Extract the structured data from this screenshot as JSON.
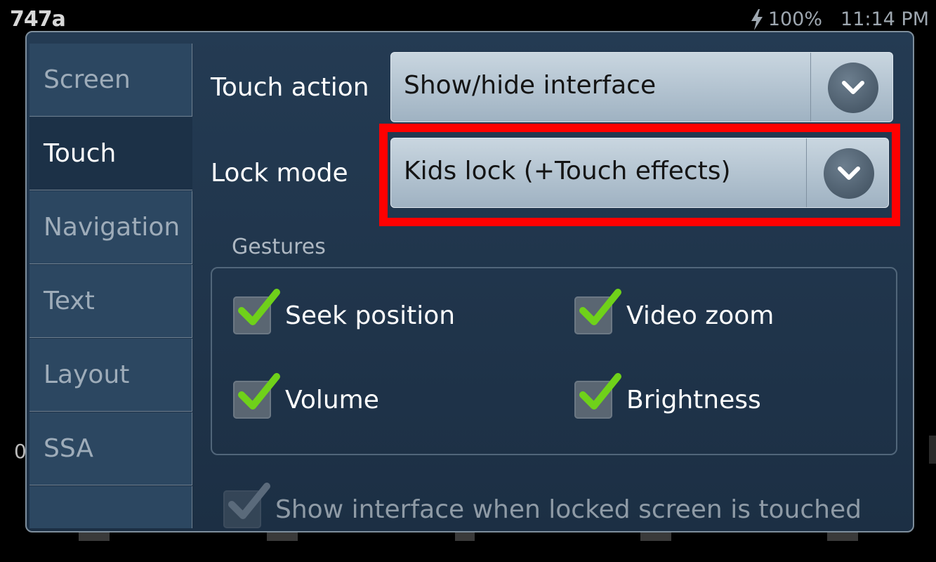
{
  "status_bar": {
    "app_title": "747a",
    "battery": "100%",
    "time": "11:14 PM",
    "icons": [
      "charging-bolt-icon"
    ]
  },
  "background": {
    "partial_text": "0"
  },
  "sidebar": {
    "items": [
      {
        "label": "Screen",
        "active": false
      },
      {
        "label": "Touch",
        "active": true
      },
      {
        "label": "Navigation",
        "active": false
      },
      {
        "label": "Text",
        "active": false
      },
      {
        "label": "Layout",
        "active": false
      },
      {
        "label": "SSA",
        "active": false
      }
    ]
  },
  "touch_action": {
    "label": "Touch action",
    "value": "Show/hide interface",
    "icon": "chevron-down-icon"
  },
  "lock_mode": {
    "label": "Lock mode",
    "value": "Kids lock (+Touch effects)",
    "icon": "chevron-down-icon",
    "highlight_color": "#ff0000"
  },
  "gestures": {
    "title": "Gestures",
    "items": [
      {
        "label": "Seek position",
        "checked": true
      },
      {
        "label": "Video zoom",
        "checked": true
      },
      {
        "label": "Volume",
        "checked": true
      },
      {
        "label": "Brightness",
        "checked": true
      }
    ]
  },
  "show_interface": {
    "label": "Show interface when locked screen is touched",
    "checked": true,
    "enabled": false
  },
  "colors": {
    "checkmark": "#6fd11a",
    "dialog_bg": "#1c2f44",
    "sidebar_bg": "#2c4761"
  }
}
